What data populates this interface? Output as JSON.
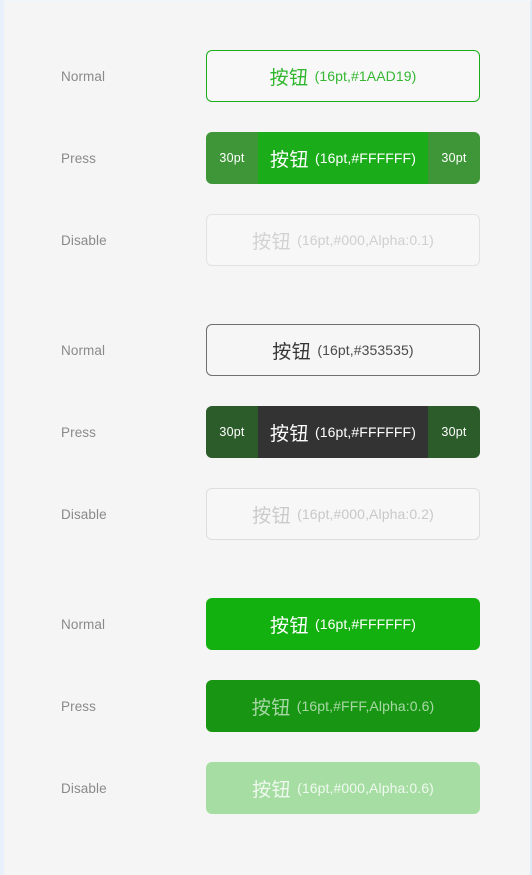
{
  "page": {
    "background_color": "#F5F5F5",
    "frame_color": "#E8F1FB"
  },
  "labels": {
    "normal": "Normal",
    "press": "Press",
    "disable": "Disable"
  },
  "button_text": {
    "cjk": "按钮",
    "pad": "30pt"
  },
  "colors": {
    "brand_green": "#1AAD19",
    "solid_green": "#13B10F",
    "press_green": "#189613",
    "press_side_green": "#3F9638",
    "press_side_dark_green": "#2C5C2A",
    "press_core_dark": "#333333",
    "disable_green": "#A6DDA3",
    "dark_text": "#353535",
    "label_gray": "#8A8A8A"
  },
  "groups": [
    {
      "name": "outline-green-button-group",
      "rows": [
        {
          "state_label": "Normal",
          "style": "outline-green",
          "cjk": "按钮",
          "meta": "(16pt,#1AAD19)",
          "has_pads": false
        },
        {
          "state_label": "Press",
          "style": "press-green",
          "cjk": "按钮",
          "meta": "(16pt,#FFFFFF)",
          "has_pads": true,
          "pad_left": "30pt",
          "pad_right": "30pt"
        },
        {
          "state_label": "Disable",
          "style": "disable-outline",
          "cjk": "按钮",
          "meta": "(16pt,#000,Alpha:0.1)",
          "has_pads": false
        }
      ]
    },
    {
      "name": "outline-dark-button-group",
      "rows": [
        {
          "state_label": "Normal",
          "style": "outline-dark",
          "cjk": "按钮",
          "meta": "(16pt,#353535)",
          "has_pads": false
        },
        {
          "state_label": "Press",
          "style": "press-dark",
          "cjk": "按钮",
          "meta": "(16pt,#FFFFFF)",
          "has_pads": true,
          "pad_left": "30pt",
          "pad_right": "30pt"
        },
        {
          "state_label": "Disable",
          "style": "disable-outline-2",
          "cjk": "按钮",
          "meta": "(16pt,#000,Alpha:0.2)",
          "has_pads": false
        }
      ]
    },
    {
      "name": "solid-green-button-group",
      "rows": [
        {
          "state_label": "Normal",
          "style": "solid-green",
          "cjk": "按钮",
          "meta": "(16pt,#FFFFFF)",
          "has_pads": false
        },
        {
          "state_label": "Press",
          "style": "solid-press",
          "cjk": "按钮",
          "meta": "(16pt,#FFF,Alpha:0.6)",
          "has_pads": false
        },
        {
          "state_label": "Disable",
          "style": "solid-disable",
          "cjk": "按钮",
          "meta": "(16pt,#000,Alpha:0.6)",
          "has_pads": false
        }
      ]
    }
  ]
}
